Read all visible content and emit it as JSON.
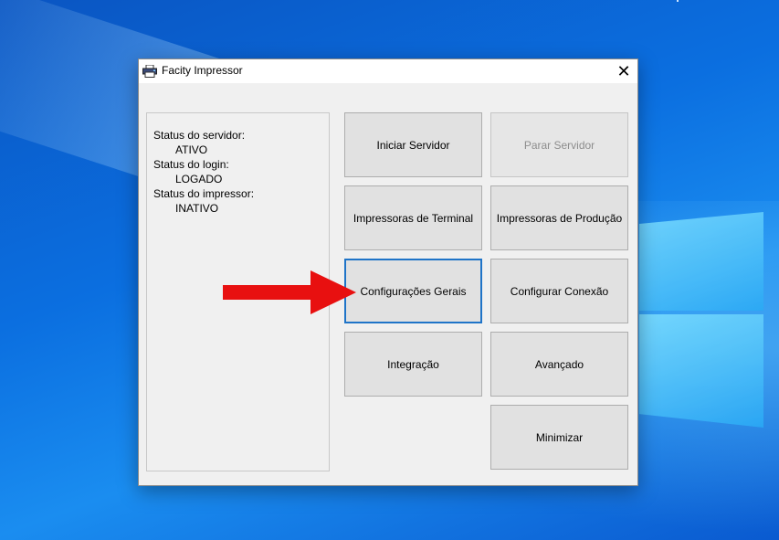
{
  "window": {
    "title": "Facity Impressor",
    "close_glyph": "✕"
  },
  "status": {
    "server_label": "Status do servidor:",
    "server_value": "ATIVO",
    "login_label": "Status do login:",
    "login_value": "LOGADO",
    "printer_label": "Status do impressor:",
    "printer_value": "INATIVO"
  },
  "buttons": {
    "start_server": "Iniciar Servidor",
    "stop_server": "Parar Servidor",
    "terminal_printers": "Impressoras de Terminal",
    "production_printers": "Impressoras de Produção",
    "general_settings": "Configurações Gerais",
    "configure_connection": "Configurar Conexão",
    "integration": "Integração",
    "advanced": "Avançado",
    "minimize": "Minimizar"
  },
  "colors": {
    "arrow": "#e81010",
    "focus_border": "#1f74c8"
  }
}
